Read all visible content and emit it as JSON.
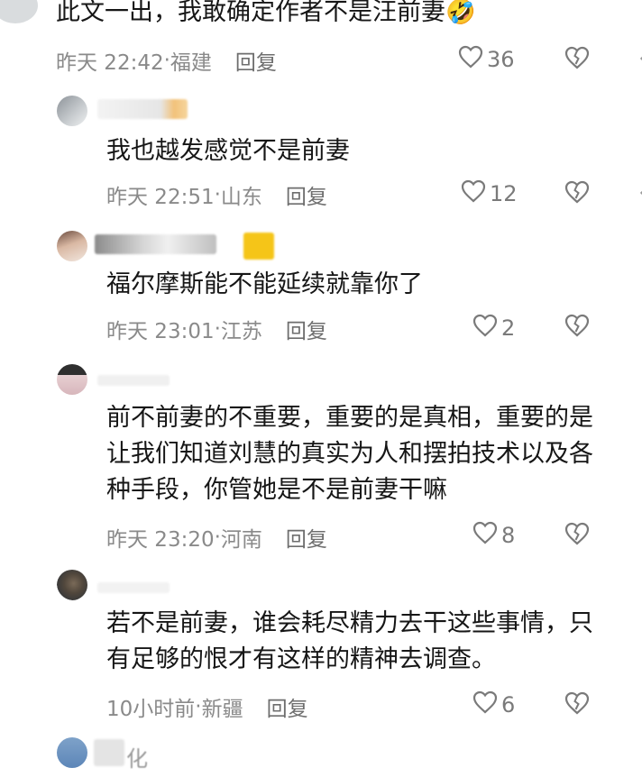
{
  "comments": [
    {
      "text": [
        "此文一出，我敢确定作者不是汪前妻🤣"
      ],
      "time": "昨天 22:42",
      "location": "福建",
      "reply": "回复",
      "likes": "36"
    },
    {
      "text": [
        "我也越发感觉不是前妻"
      ],
      "time": "昨天 22:51",
      "location": "山东",
      "reply": "回复",
      "likes": "12"
    },
    {
      "text": [
        "福尔摩斯能不能延续就靠你了"
      ],
      "time": "昨天 23:01",
      "location": "江苏",
      "reply": "回复",
      "likes": "2"
    },
    {
      "text": [
        "前不前妻的不重要，重要的是真相，重要的是",
        "让我们知道刘慧的真实为人和摆拍技术以及各",
        "种手段，你管她是不是前妻干嘛"
      ],
      "time": "昨天 23:20",
      "location": "河南",
      "reply": "回复",
      "likes": "8"
    },
    {
      "text": [
        "若不是前妻，谁会耗尽精力去干这些事情，只",
        "有足够的恨才有这样的精神去调查。"
      ],
      "time": "10小时前",
      "location": "新疆",
      "reply": "回复",
      "likes": "6"
    }
  ],
  "partial_name_fragment": "化",
  "icons": {
    "like": "heart-outline-icon",
    "dislike": "broken-heart-outline-icon",
    "more": "more-icon"
  },
  "colors": {
    "text": "#161616",
    "meta": "#8a8a8a",
    "icon": "#7a7a7a"
  }
}
